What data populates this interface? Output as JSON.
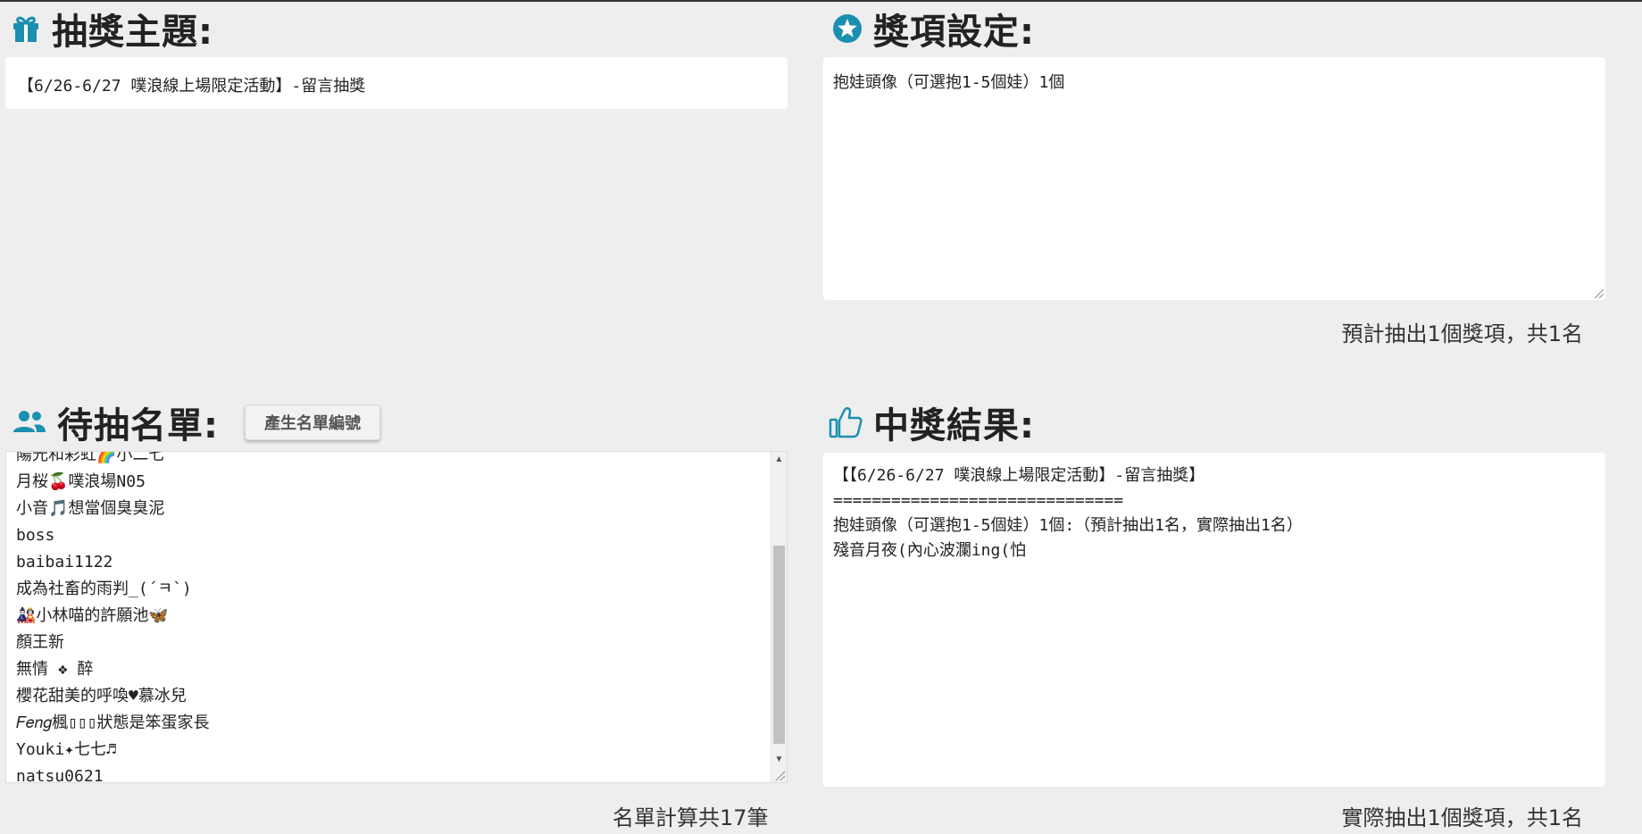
{
  "lottery_topic": {
    "title": "抽獎主題:",
    "value": "【6/26-6/27 噗浪線上場限定活動】-留言抽獎"
  },
  "prize_settings": {
    "title": "獎項設定:",
    "value": "抱娃頭像（可選抱1-5個娃）1個",
    "summary": "預計抽出1個獎項，共1名"
  },
  "candidate_list": {
    "title": "待抽名單:",
    "generate_button": "產生名單編號",
    "entries": [
      "陽光和彩虹🌈小二七",
      "月桜🍒噗浪場N05",
      "小音🎵想當個臭臭泥",
      "boss",
      "baibai1122",
      "成為社畜的雨判_(´ㅋ`)",
      "🎎小林喵的許願池🦋",
      "顏王新",
      "無情 ❖ 醉",
      "櫻花甜美的呼喚♥慕冰兒",
      "𝐹𝑒𝑛𝑔楓▯▯▯狀態是笨蛋家長",
      "Youki✦七七♬",
      "natsu0621"
    ],
    "count_text": "名單計算共17筆"
  },
  "results": {
    "title": "中獎結果:",
    "lines": [
      "【【6/26-6/27 噗浪線上場限定活動】-留言抽獎】",
      "==============================",
      "抱娃頭像（可選抱1-5個娃）1個:（預計抽出1名，實際抽出1名）",
      "殘音月夜(內心波瀾ing(怕"
    ],
    "summary": "實際抽出1個獎項，共1名"
  },
  "colors": {
    "accent": "#1b8fb0",
    "background": "#eeeeee"
  }
}
